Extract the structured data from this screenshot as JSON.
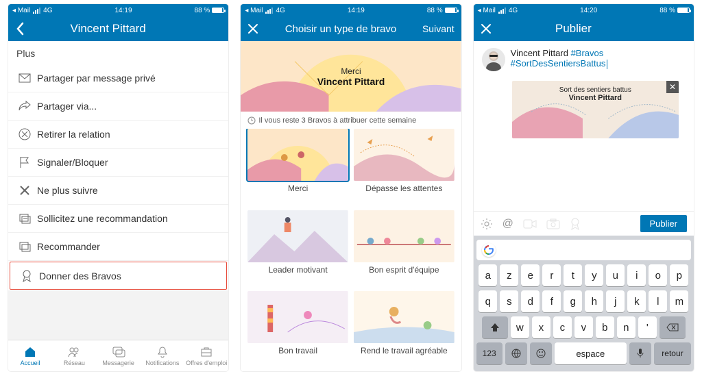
{
  "status": {
    "back_app": "Mail",
    "net": "4G",
    "time1": "14:19",
    "time2": "14:19",
    "time3": "14:20",
    "batt": "88 %"
  },
  "colors": {
    "brand": "#0077b5"
  },
  "screen1": {
    "title": "Vincent Pittard",
    "section": "Plus",
    "items": [
      {
        "icon": "mail-icon",
        "label": "Partager par message privé"
      },
      {
        "icon": "share-arrow-icon",
        "label": "Partager via..."
      },
      {
        "icon": "remove-x-circle-icon",
        "label": "Retirer la relation"
      },
      {
        "icon": "flag-icon",
        "label": "Signaler/Bloquer"
      },
      {
        "icon": "x-icon",
        "label": "Ne plus suivre"
      },
      {
        "icon": "quote-request-icon",
        "label": "Sollicitez une recommandation"
      },
      {
        "icon": "quote-give-icon",
        "label": "Recommander"
      },
      {
        "icon": "ribbon-icon",
        "label": "Donner des Bravos",
        "highlight": true
      }
    ],
    "tabs": [
      {
        "icon": "home-icon",
        "label": "Accueil",
        "active": true
      },
      {
        "icon": "people-icon",
        "label": "Réseau"
      },
      {
        "icon": "chat-icon",
        "label": "Messagerie"
      },
      {
        "icon": "bell-icon",
        "label": "Notifications"
      },
      {
        "icon": "briefcase-icon",
        "label": "Offres d'emploi"
      }
    ]
  },
  "screen2": {
    "title": "Choisir un type de bravo",
    "next": "Suivant",
    "hero_small": "Merci",
    "hero_big": "Vincent Pittard",
    "quota": "Il vous reste 3 Bravos à attribuer cette semaine",
    "cards": [
      {
        "label": "Merci",
        "selected": true
      },
      {
        "label": "Dépasse les attentes"
      },
      {
        "label": "Leader motivant"
      },
      {
        "label": "Bon esprit d'équipe"
      },
      {
        "label": "Bon travail"
      },
      {
        "label": "Rend le travail agréable"
      }
    ]
  },
  "screen3": {
    "title": "Publier",
    "text_plain": "Vincent Pittard ",
    "hash1": "#Bravos",
    "hash2": "#SortDesSentiersBattus",
    "preview_small": "Sort des sentiers battus",
    "preview_big": "Vincent Pittard",
    "publish": "Publier",
    "key_rows": [
      [
        "a",
        "z",
        "e",
        "r",
        "t",
        "y",
        "u",
        "i",
        "o",
        "p"
      ],
      [
        "q",
        "s",
        "d",
        "f",
        "g",
        "h",
        "j",
        "k",
        "l",
        "m"
      ]
    ],
    "row3_keys": [
      "w",
      "x",
      "c",
      "v",
      "b",
      "n",
      "'"
    ],
    "mod123": "123",
    "space": "espace",
    "ret": "retour"
  }
}
